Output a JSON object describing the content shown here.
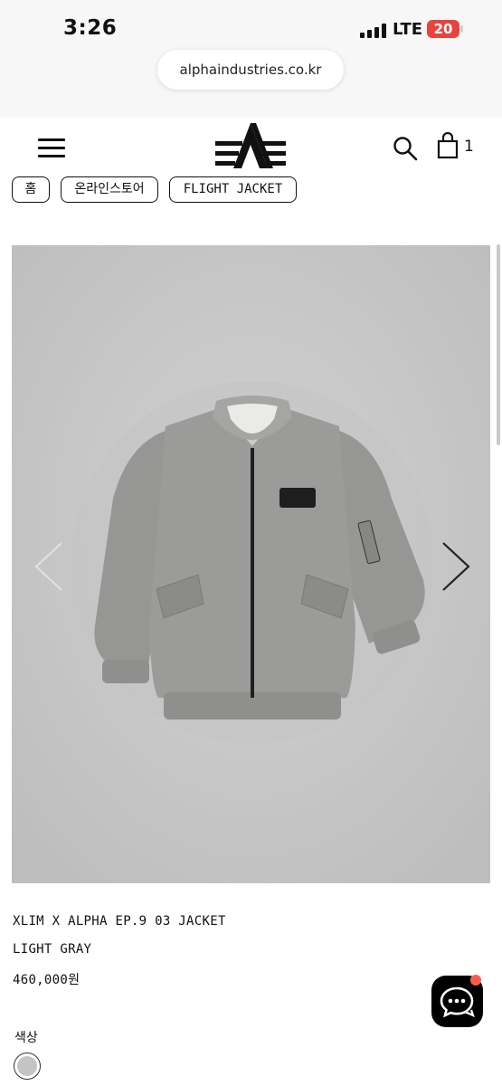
{
  "status_bar": {
    "time": "3:26",
    "network": "LTE",
    "battery": "20"
  },
  "browser": {
    "url": "alphaindustries.co.kr"
  },
  "header": {
    "cart_count": "1"
  },
  "breadcrumbs": [
    "홈",
    "온라인스토어",
    "FLIGHT JACKET"
  ],
  "product": {
    "name": "XLIM X ALPHA EP.9 03 JACKET",
    "color_name": "LIGHT GRAY",
    "price": "460,000원",
    "color_label": "색상",
    "swatch_color": "#c4c4c4"
  },
  "colors": {
    "accent_red": "#e9433d",
    "image_bg": "#c9c9c9",
    "jacket": "#9a9a98"
  }
}
